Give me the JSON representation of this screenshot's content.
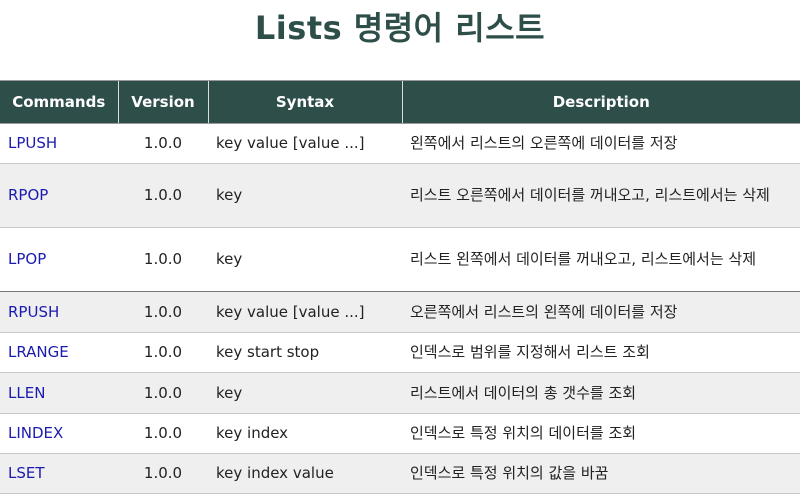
{
  "title": "Lists 명령어 리스트",
  "columns": [
    "Commands",
    "Version",
    "Syntax",
    "Description"
  ],
  "rows": [
    {
      "command": "LPUSH",
      "version": "1.0.0",
      "syntax": "key value [value ...]",
      "description": "왼쪽에서 리스트의 오른쪽에 데이터를 저장"
    },
    {
      "command": "RPOP",
      "version": "1.0.0",
      "syntax": "key",
      "description": "리스트 오른쪽에서 데이터를 꺼내오고, 리스트에서는 삭제"
    },
    {
      "command": "LPOP",
      "version": "1.0.0",
      "syntax": "key",
      "description": "리스트 왼쪽에서 데이터를 꺼내오고, 리스트에서는 삭제"
    },
    {
      "command": "RPUSH",
      "version": "1.0.0",
      "syntax": "key value [value ...]",
      "description": "오른쪽에서 리스트의 왼쪽에 데이터를 저장"
    },
    {
      "command": "LRANGE",
      "version": "1.0.0",
      "syntax": "key start stop",
      "description": "인덱스로 범위를 지정해서 리스트 조회"
    },
    {
      "command": "LLEN",
      "version": "1.0.0",
      "syntax": "key",
      "description": "리스트에서 데이터의 총 갯수를 조회"
    },
    {
      "command": "LINDEX",
      "version": "1.0.0",
      "syntax": "key index",
      "description": "인덱스로 특정 위치의 데이터를 조회"
    },
    {
      "command": "LSET",
      "version": "1.0.0",
      "syntax": "key index value",
      "description": "인덱스로 특정 위치의 값을 바꿈"
    }
  ],
  "colors": {
    "header_bg": "#2e4e4a",
    "title": "#2e4e4a",
    "link": "#1a1ab0",
    "stripe": "#efefef"
  }
}
